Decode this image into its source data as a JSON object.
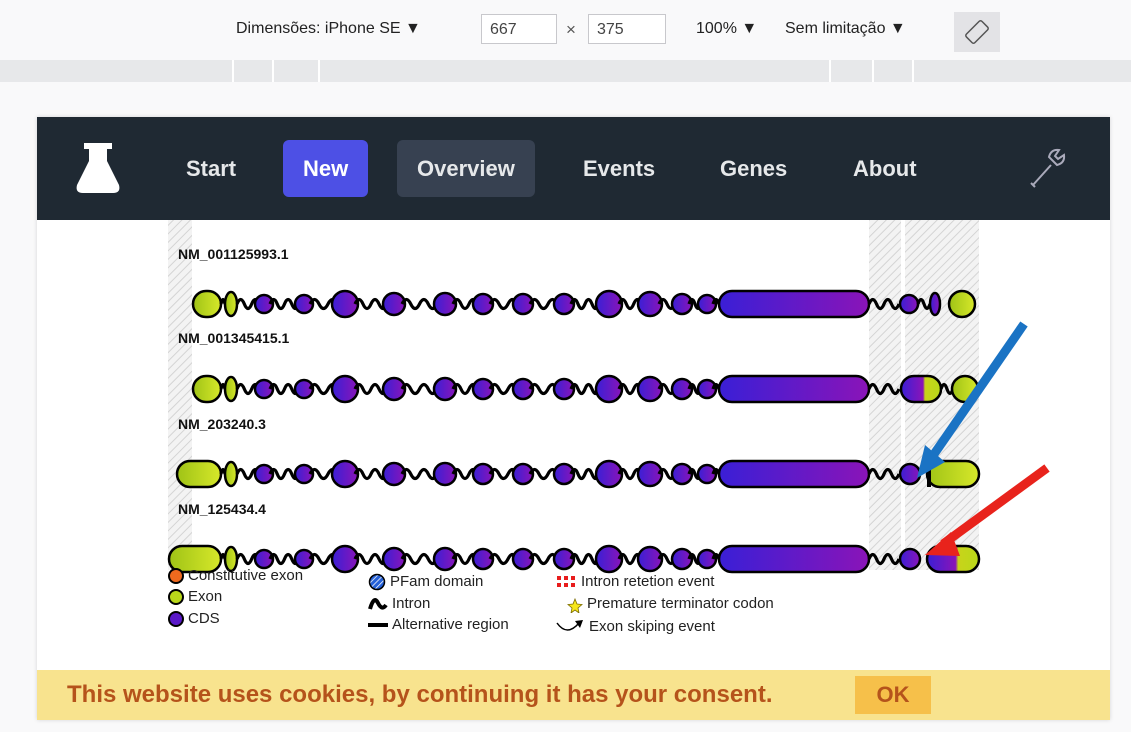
{
  "devtools": {
    "dimensions_label": "Dimensões: iPhone SE ▼",
    "width_value": "667",
    "times": "×",
    "height_value": "375",
    "zoom_label": "100% ▼",
    "throttle_label": "Sem limitação ▼",
    "rotate_icon": "rotate-icon"
  },
  "navbar": {
    "logo_icon": "flask-icon",
    "items": [
      {
        "label": "Start",
        "state": "normal"
      },
      {
        "label": "New",
        "state": "active"
      },
      {
        "label": "Overview",
        "state": "hover"
      },
      {
        "label": "Events",
        "state": "normal"
      },
      {
        "label": "Genes",
        "state": "normal"
      },
      {
        "label": "About",
        "state": "normal"
      }
    ],
    "settings_icon": "wrench-icon"
  },
  "transcripts": [
    {
      "name": "NM_001125993.1"
    },
    {
      "name": "NM_001345415.1"
    },
    {
      "name": "NM_203240.3"
    },
    {
      "name": "NM_125434.4"
    }
  ],
  "legend": {
    "col1": [
      "Constitutive exon",
      "Exon",
      "CDS"
    ],
    "col2": [
      "PFam domain",
      "Intron",
      "Alternative region"
    ],
    "col3": [
      "Intron retetion event",
      "Premature terminator codon",
      "Exon skiping event"
    ]
  },
  "colors": {
    "exon": "#b9d81a",
    "cds_start": "#3a1fd6",
    "cds_end": "#8a14b8",
    "constitutive": "#f06a1e",
    "arrow_blue": "#1a73c4",
    "arrow_red": "#e8231c"
  },
  "cookie": {
    "message": "This website uses cookies, by continuing it has your consent.",
    "button": "OK"
  }
}
